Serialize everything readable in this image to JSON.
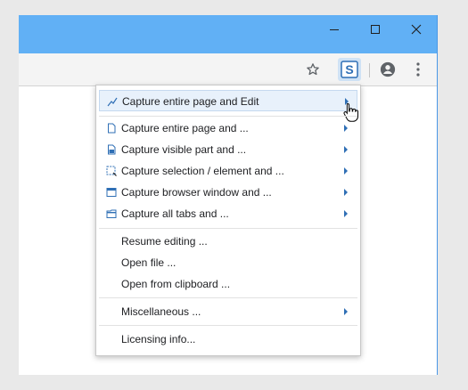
{
  "browser": {
    "window_controls": {
      "minimize_icon": "minimize-icon",
      "maximize_icon": "maximize-icon",
      "close_icon": "close-icon"
    },
    "toolbar": {
      "bookmark_icon": "star-icon",
      "extension_icon": "screenshot-extension-icon",
      "extension_letter": "S",
      "account_icon": "account-icon",
      "menu_icon": "kebab-menu-icon"
    },
    "colors": {
      "titlebar": "#61b0f5",
      "menu_highlight": "#e8f1fb",
      "icon_blue": "#2f6fb5"
    }
  },
  "menu": {
    "items": [
      {
        "label": "Capture entire page and Edit",
        "icon": "edit-pencil-icon",
        "submenu": true,
        "highlighted": true
      },
      {
        "label": "Capture entire page and ...",
        "icon": "page-icon",
        "submenu": true
      },
      {
        "label": "Capture visible part and ...",
        "icon": "visible-part-icon",
        "submenu": true
      },
      {
        "label": "Capture selection / element and ...",
        "icon": "selection-icon",
        "submenu": true
      },
      {
        "label": "Capture browser window and ...",
        "icon": "browser-window-icon",
        "submenu": true
      },
      {
        "label": "Capture all tabs and ...",
        "icon": "all-tabs-icon",
        "submenu": true
      },
      {
        "label": "Resume editing ...",
        "submenu": false
      },
      {
        "label": "Open file ...",
        "submenu": false
      },
      {
        "label": "Open from clipboard ...",
        "submenu": false
      },
      {
        "label": "Miscellaneous ...",
        "submenu": true
      },
      {
        "label": "Licensing info...",
        "submenu": false
      }
    ]
  }
}
